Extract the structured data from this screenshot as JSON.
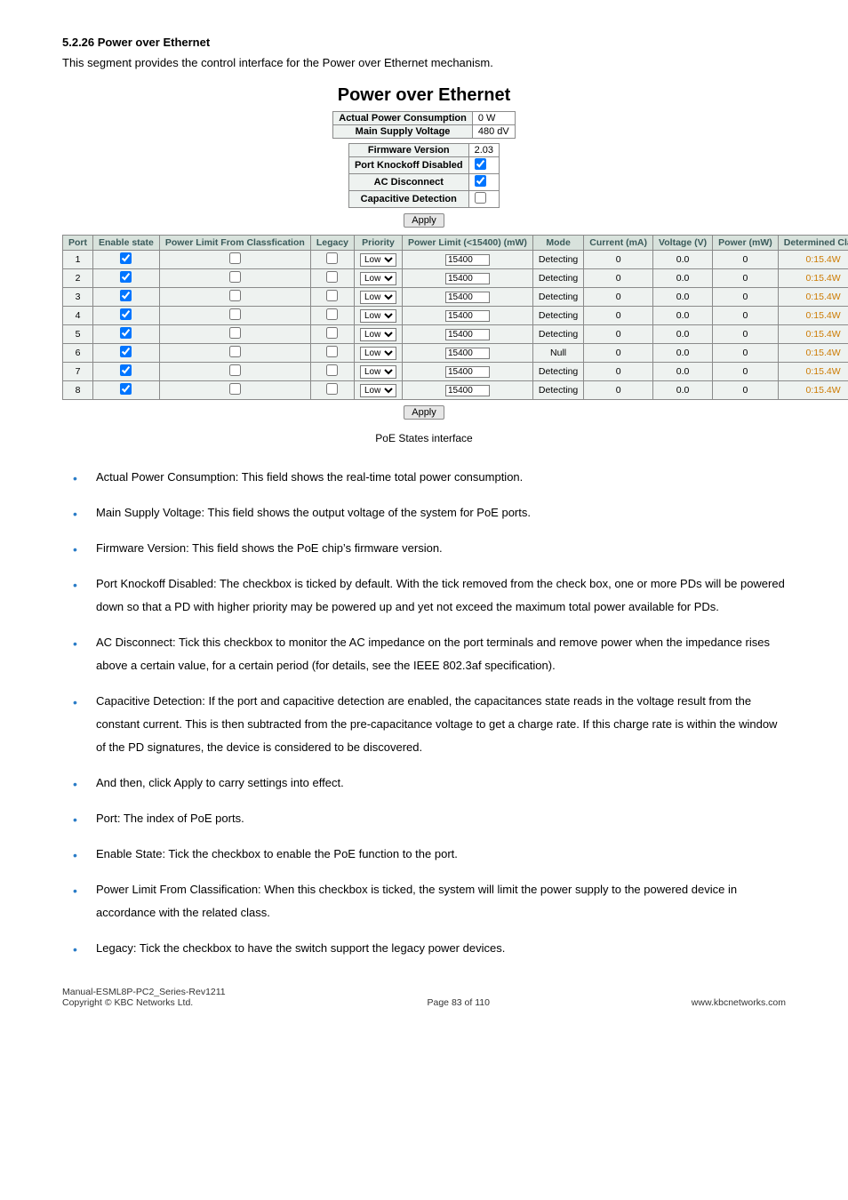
{
  "section": {
    "heading": "5.2.26 Power over Ethernet"
  },
  "intro": "This segment provides the control interface for the Power over Ethernet mechanism.",
  "poe_title": "Power over Ethernet",
  "top_info": {
    "actual_label": "Actual Power Consumption",
    "actual_val": "0 W",
    "voltage_label": "Main Supply Voltage",
    "voltage_val": "480 dV"
  },
  "settings": {
    "fw_label": "Firmware Version",
    "fw_val": "2.03",
    "knockoff_label": "Port Knockoff Disabled",
    "acdisc_label": "AC Disconnect",
    "capdet_label": "Capacitive Detection"
  },
  "apply_label": "Apply",
  "headers": {
    "port": "Port",
    "enable": "Enable\nstate",
    "plfc": "Power Limit From\nClassfication",
    "legacy": "Legacy",
    "priority": "Priority",
    "plimit": "Power Limit\n(<15400)\n(mW)",
    "mode": "Mode",
    "current": "Current\n(mA)",
    "voltage": "Voltage\n(V)",
    "power": "Power\n(mW)",
    "detclass": "Determined\nClass"
  },
  "rows": [
    {
      "port": "1",
      "pri": "Low",
      "pl": "15400",
      "mode": "Detecting",
      "cur": "0",
      "v": "0.0",
      "pw": "0",
      "dc": "0:15.4W"
    },
    {
      "port": "2",
      "pri": "Low",
      "pl": "15400",
      "mode": "Detecting",
      "cur": "0",
      "v": "0.0",
      "pw": "0",
      "dc": "0:15.4W"
    },
    {
      "port": "3",
      "pri": "Low",
      "pl": "15400",
      "mode": "Detecting",
      "cur": "0",
      "v": "0.0",
      "pw": "0",
      "dc": "0:15.4W"
    },
    {
      "port": "4",
      "pri": "Low",
      "pl": "15400",
      "mode": "Detecting",
      "cur": "0",
      "v": "0.0",
      "pw": "0",
      "dc": "0:15.4W"
    },
    {
      "port": "5",
      "pri": "Low",
      "pl": "15400",
      "mode": "Detecting",
      "cur": "0",
      "v": "0.0",
      "pw": "0",
      "dc": "0:15.4W"
    },
    {
      "port": "6",
      "pri": "Low",
      "pl": "15400",
      "mode": "Null",
      "cur": "0",
      "v": "0.0",
      "pw": "0",
      "dc": "0:15.4W"
    },
    {
      "port": "7",
      "pri": "Low",
      "pl": "15400",
      "mode": "Detecting",
      "cur": "0",
      "v": "0.0",
      "pw": "0",
      "dc": "0:15.4W"
    },
    {
      "port": "8",
      "pri": "Low",
      "pl": "15400",
      "mode": "Detecting",
      "cur": "0",
      "v": "0.0",
      "pw": "0",
      "dc": "0:15.4W"
    }
  ],
  "caption": "PoE States interface",
  "bullets": [
    "Actual Power Consumption: This field shows the real-time total power consumption.",
    "Main Supply Voltage: This field shows the output voltage of the system for PoE ports.",
    "Firmware Version: This field shows the PoE chip’s firmware version.",
    "Port Knockoff Disabled: The checkbox is ticked by default. With the tick removed from the check box, one or more PDs will be powered down so that a PD with higher priority may be powered up and yet not exceed the maximum total power available for PDs.",
    "AC Disconnect: Tick this checkbox to monitor the AC impedance on the port terminals and remove power when the impedance rises above a certain value, for a certain period (for details, see the IEEE 802.3af specification).",
    "Capacitive Detection: If the port and capacitive detection are enabled, the capacitances state reads in the voltage result from the constant current. This is then subtracted from the pre-capacitance voltage to get a charge rate. If this charge rate is within the window of the PD signatures, the device is considered to be discovered.",
    "And then, click Apply to carry settings into effect.",
    "Port: The index of PoE ports.",
    "Enable State: Tick the checkbox to enable the PoE function to the port.",
    "Power Limit From Classification: When this checkbox is ticked, the system will limit the power supply to the powered device in accordance with the related class.",
    "Legacy: Tick the checkbox to have the switch support the legacy power devices."
  ],
  "footer": {
    "left1": "Manual-ESML8P-PC2_Series-Rev1211",
    "left2": "Copyright © KBC Networks Ltd.",
    "center": "Page 83 of 110",
    "right": "www.kbcnetworks.com"
  }
}
